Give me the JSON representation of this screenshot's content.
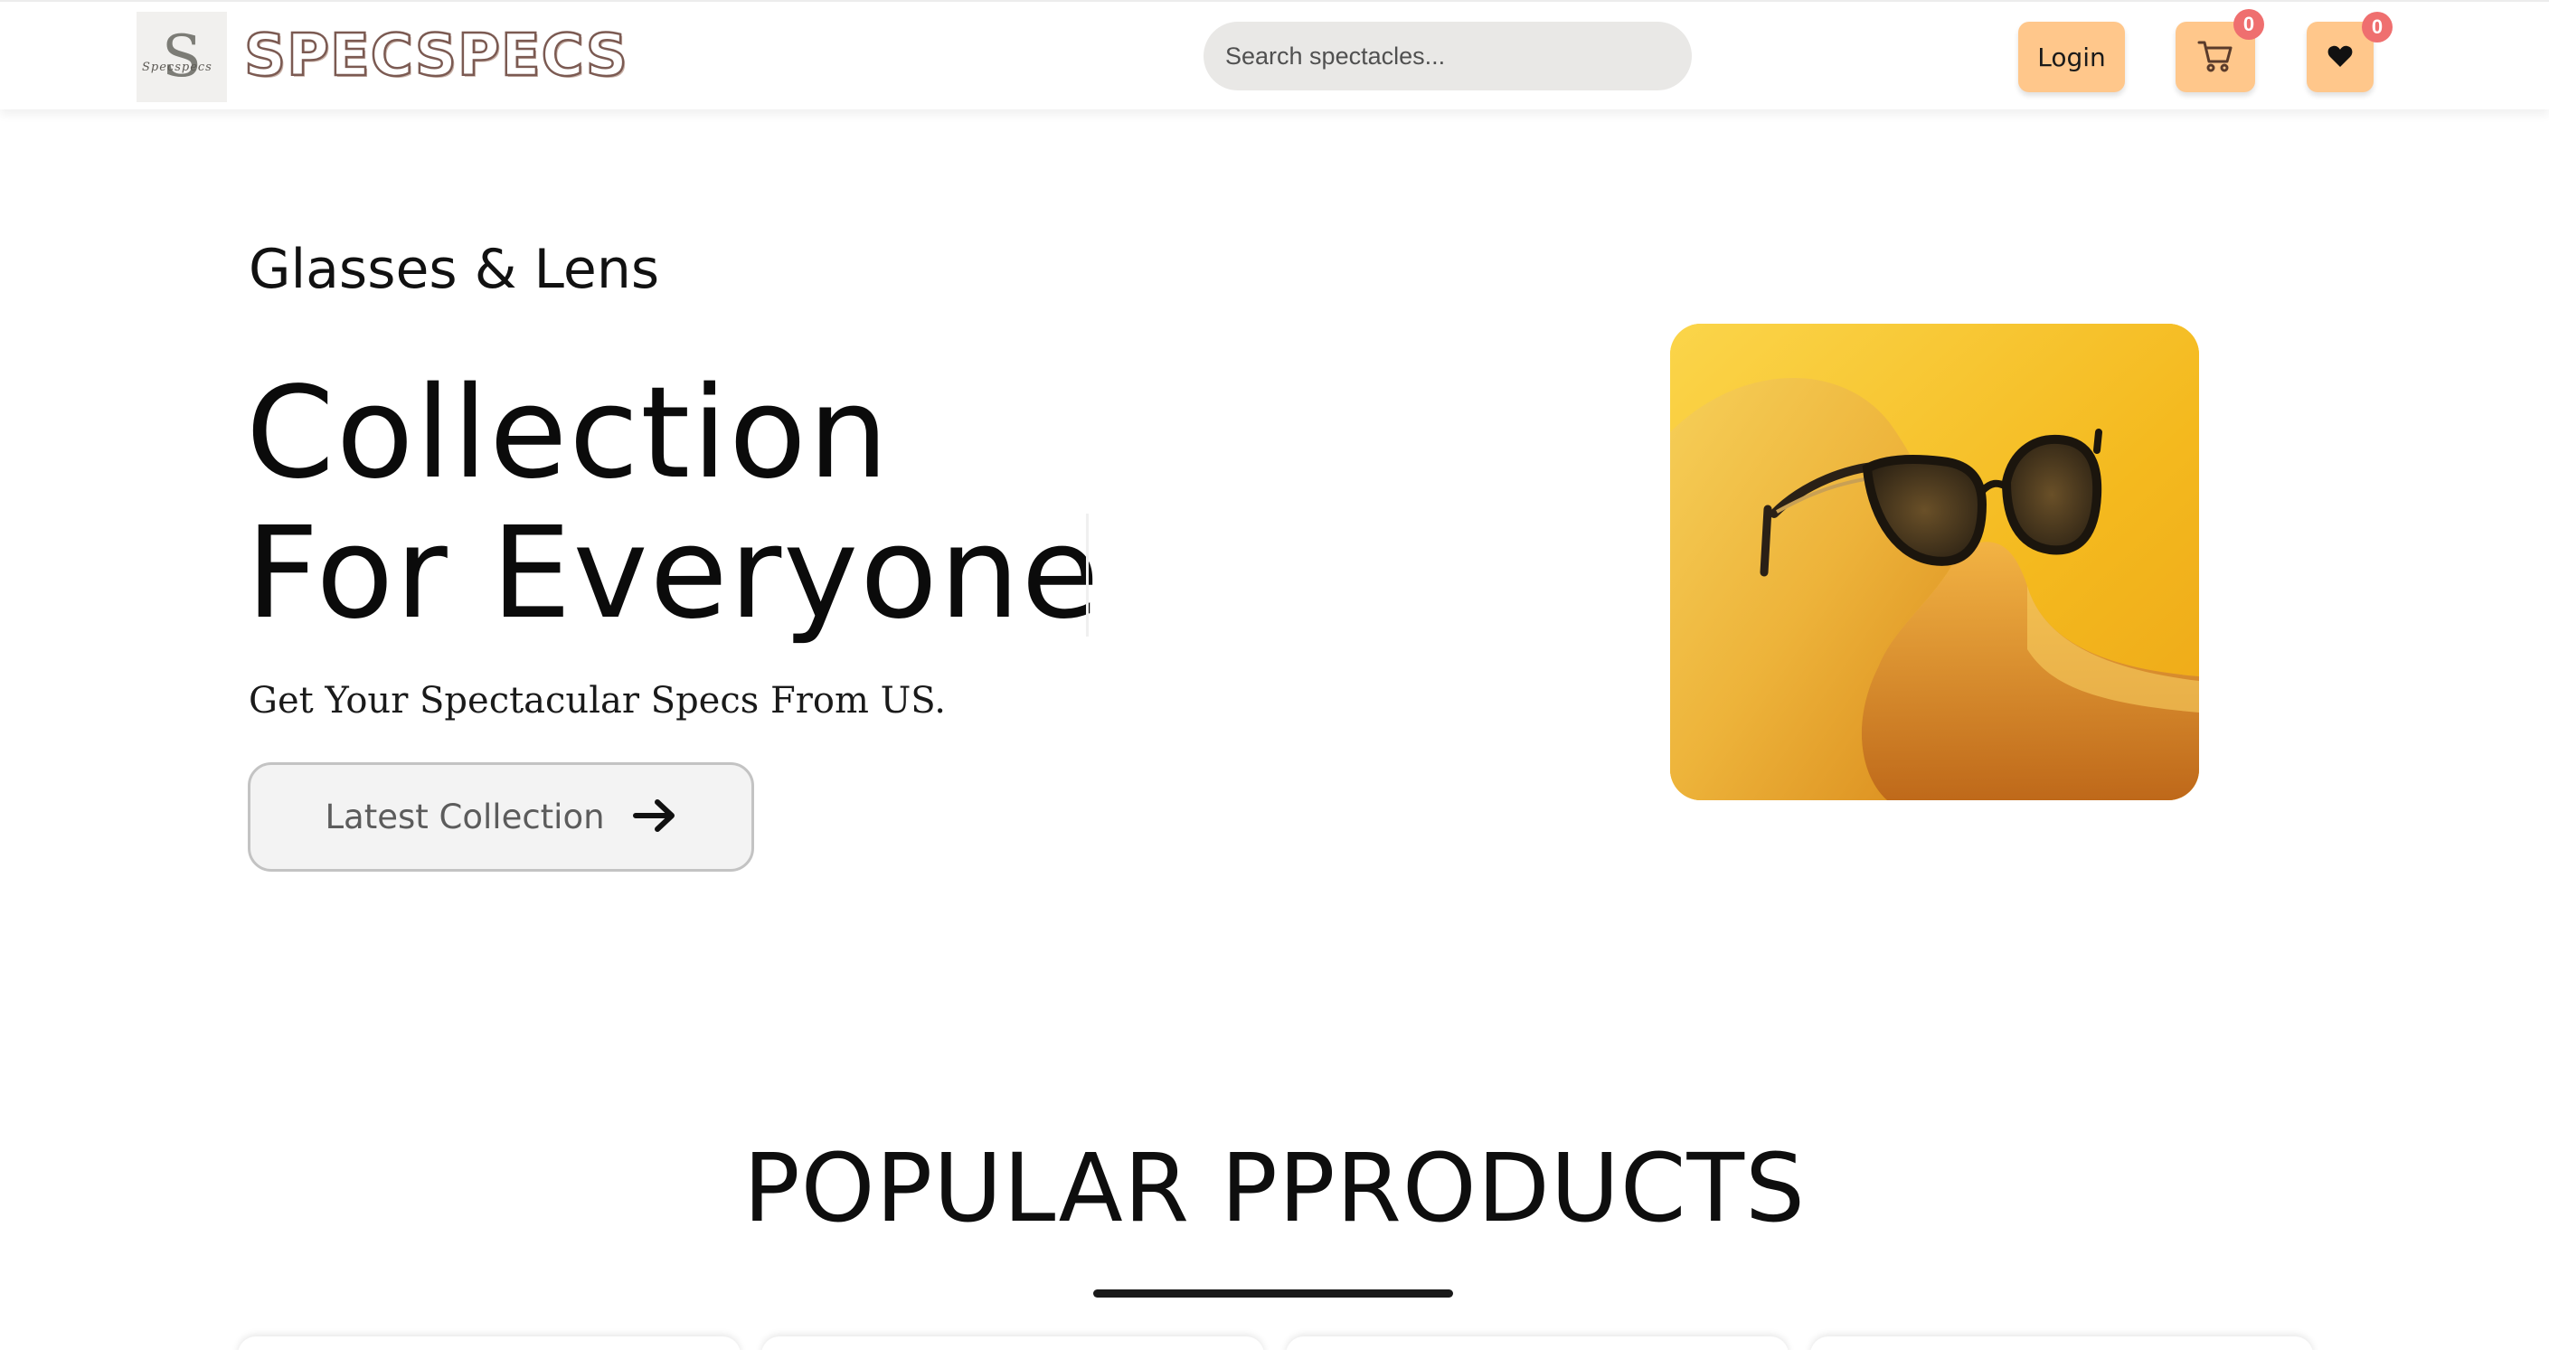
{
  "brand": {
    "name": "SPECSPECS",
    "logo_mark": "S",
    "logo_script": "Specspecs"
  },
  "header": {
    "search_placeholder": "Search spectacles...",
    "login_label": "Login",
    "cart_count": "0",
    "wishlist_count": "0"
  },
  "hero": {
    "eyebrow": "Glasses & Lens",
    "title_line1": "Collection",
    "title_line2": "For Everyone",
    "subtitle": "Get Your Spectacular Specs From US.",
    "cta_label": "Latest Collection",
    "cta_icon": "arrow-right-icon",
    "image": "sunglasses-on-yellow-paper"
  },
  "popular": {
    "heading": "POPULAR PPRODUCTS",
    "cards": [
      {},
      {},
      {},
      {}
    ]
  },
  "colors": {
    "accent": "#ffc78b",
    "badge": "#ef6f6f",
    "search_bg": "#e9e8e6",
    "hero_image_bg": "#f5bc20",
    "brand_stroke": "#7b5a52"
  }
}
